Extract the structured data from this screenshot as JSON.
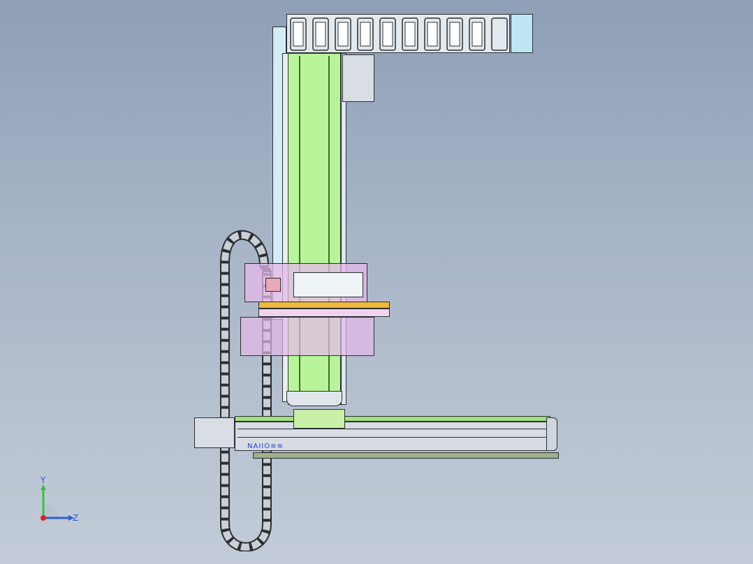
{
  "view": {
    "background_top": "#8e9fb6",
    "background_bottom": "#c3ccd8"
  },
  "colors": {
    "column_body": "#b8f59a",
    "column_rail": "#d4ecf5",
    "carriage_overlay": "#e6b8ea",
    "slide_plate": "#f0b83c",
    "x_axis_body": "#d7dde3",
    "x_axis_top_strip": "#9ee07e",
    "base_plate": "#9fb08a",
    "motor": "#d9dee4",
    "chain": "#c9cfd4",
    "chain_end": "#bfe6f5",
    "brand_color": "#2e3cd6"
  },
  "axis_module": {
    "brand_label": "NAIIO≋≋"
  },
  "triad": {
    "y_label": "Y",
    "z_label": "Z"
  }
}
